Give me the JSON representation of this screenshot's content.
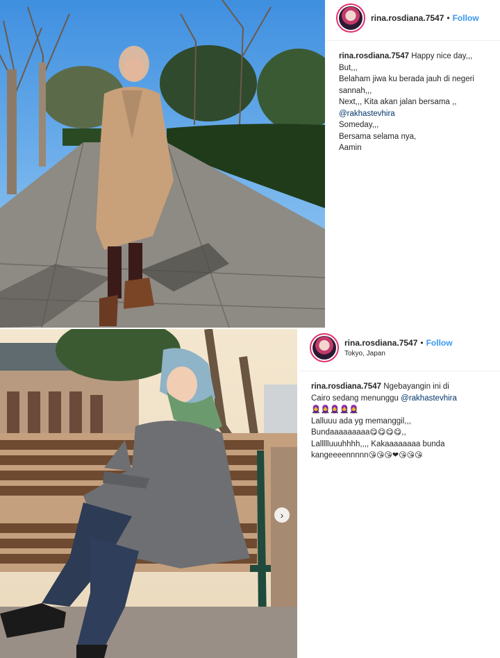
{
  "posts": [
    {
      "username": "rina.rosdiana.7547",
      "follow_label": "Follow",
      "separator": "•",
      "caption_lines": [
        "Happy nice day,,,",
        "But,,,",
        "Belaham jiwa ku berada jauh di negeri",
        "sannah,,,",
        "Next,,, Kita akan jalan bersama ,,",
        "@rakhastevhira",
        "Someday,,,",
        "Bersama selama nya,",
        "Aamin"
      ]
    },
    {
      "username": "rina.rosdiana.7547",
      "follow_label": "Follow",
      "separator": "•",
      "location": "Tokyo, Japan",
      "caption_text_1": "Ngebayangin ini di",
      "caption_text_2": "Cairo sedang menunggu",
      "mention": "@rakhastevhira",
      "emoji_row": "🧕🧕🧕🧕🧕",
      "line_3": "Lalluuu ada yg memanggil,,,",
      "line_4_text": "Bundaaaaaaaaa",
      "line_4_emoji": "😋😋😋😋",
      "line_4_end": ",,",
      "line_5": "Lallllluuuhhhh,,,, Kakaaaaaaaa bunda",
      "line_6_text": "kangeeeennnnn",
      "line_6_emoji": "😘😘😘❤😘😘😘"
    }
  ],
  "carousel_next_icon": "chevron-right-icon",
  "carousel_next_glyph": "›"
}
